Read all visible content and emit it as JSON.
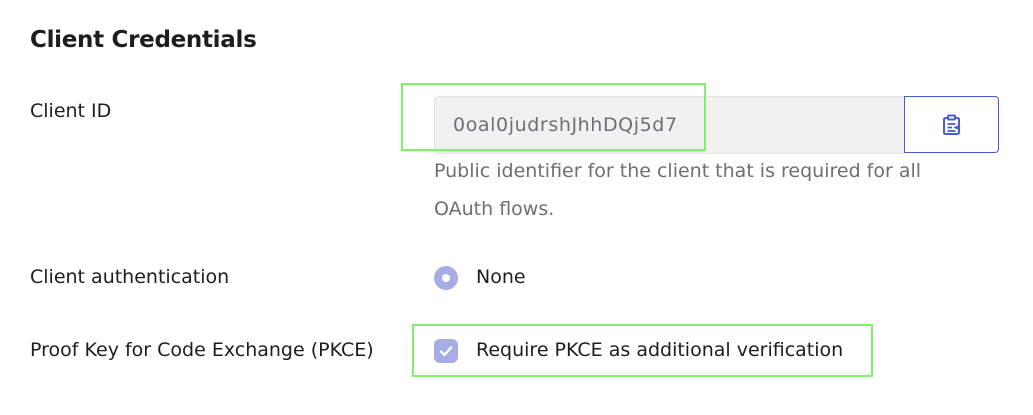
{
  "section": {
    "title": "Client Credentials"
  },
  "client_id": {
    "label": "Client ID",
    "value": "0oal0judrshJhhDQj5d7",
    "help_text": "Public identifier for the client that is required for all OAuth flows.",
    "copy_icon": "clipboard-icon"
  },
  "client_authentication": {
    "label": "Client authentication",
    "option_label": "None",
    "selected": true
  },
  "pkce": {
    "label": "Proof Key for Code Exchange (PKCE)",
    "checkbox_label": "Require PKCE as additional verification",
    "checked": true
  },
  "colors": {
    "accent": "#4a5bcb",
    "control_fill": "#a7ade4",
    "highlight": "#7ef06b",
    "muted_text": "#6e6e78"
  }
}
